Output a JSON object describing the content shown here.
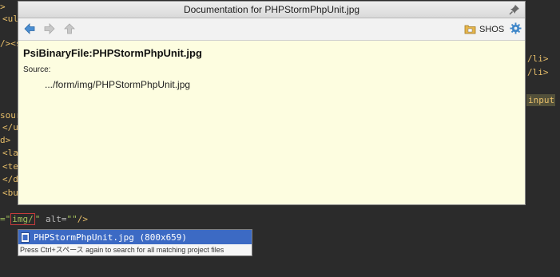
{
  "editor": {
    "left_fragments": [
      ">",
      "<ul",
      "/><s",
      "sour",
      "</u",
      "d>",
      "<lab",
      "<te:",
      "</d",
      "<but"
    ],
    "right_fragments": [
      "/li>",
      "/li>"
    ],
    "right_input_tag": "input",
    "code_line": {
      "prefix": "=\"",
      "caret_text": "img/",
      "suffix_quote": "\"",
      "alt_attr": " alt=",
      "alt_value": "\"\"",
      "close": "/>"
    }
  },
  "doc_popup": {
    "title": "Documentation for PHPStormPhpUnit.jpg",
    "toolbar": {
      "back_icon": "arrow-left-icon",
      "forward_icon": "arrow-right-icon",
      "up_icon": "arrow-up-icon",
      "folder_label": "SHOS",
      "settings_icon": "gear-icon"
    },
    "heading": "PsiBinaryFile:PHPStormPhpUnit.jpg",
    "source_label": "Source:",
    "source_path": ".../form/img/PHPStormPhpUnit.jpg"
  },
  "completion": {
    "item_label": "PHPStormPhpUnit.jpg (800x659)",
    "hint": "Press Ctrl+スペース again to search for all matching project files"
  },
  "colors": {
    "editor_bg": "#2b2b2b",
    "popup_bg": "#fdfde0",
    "selection": "#3c6ac4",
    "accent_blue": "#4a8dd1"
  }
}
